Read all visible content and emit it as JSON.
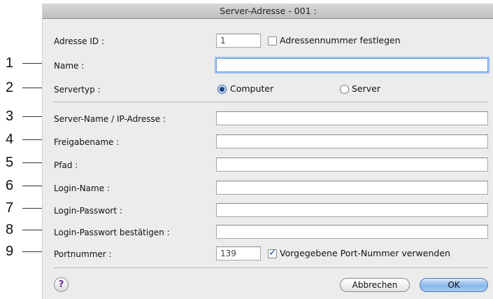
{
  "window": {
    "title": "Server-Adresse - 001 :"
  },
  "callouts": [
    "1",
    "2",
    "3",
    "4",
    "5",
    "6",
    "7",
    "8",
    "9"
  ],
  "address_id": {
    "label": "Adresse ID :",
    "value": "1",
    "checkbox_label": "Adressennummer festlegen",
    "checked": false
  },
  "name": {
    "label": "Name :",
    "value": ""
  },
  "server_type": {
    "label": "Servertyp :",
    "options": [
      "Computer",
      "Server"
    ],
    "selected": "Computer"
  },
  "server_name": {
    "label": "Server-Name / IP-Adresse :",
    "value": ""
  },
  "share_name": {
    "label": "Freigabename :",
    "value": ""
  },
  "path": {
    "label": "Pfad :",
    "value": ""
  },
  "login_name": {
    "label": "Login-Name :",
    "value": ""
  },
  "login_password": {
    "label": "Login-Passwort :",
    "value": ""
  },
  "login_password_confirm": {
    "label": "Login-Passwort bestätigen :",
    "value": ""
  },
  "port": {
    "label": "Portnummer :",
    "value": "139",
    "checkbox_label": "Vorgegebene Port-Nummer verwenden",
    "checked": true
  },
  "footer": {
    "help_symbol": "?",
    "cancel_label": "Abbrechen",
    "ok_label": "OK"
  }
}
